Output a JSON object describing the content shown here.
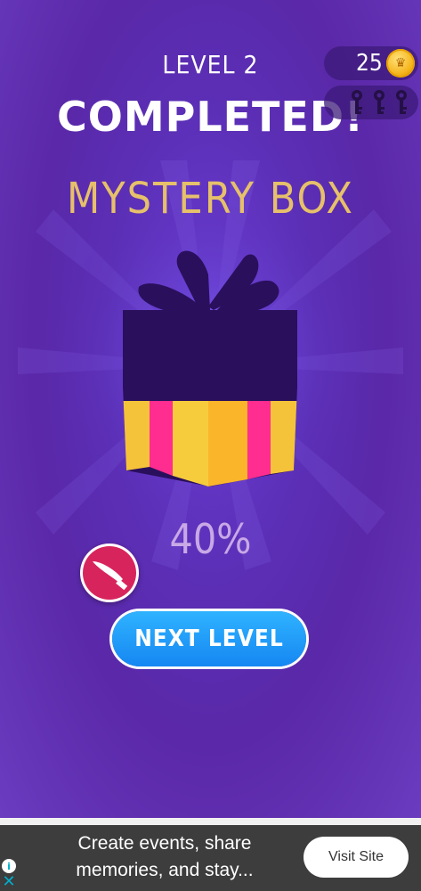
{
  "header": {
    "level_title": "LEVEL 2",
    "completed_title": "COMPLETED!"
  },
  "currency": {
    "coins": "25",
    "coin_icon": "crown-coin-icon",
    "keys_collected": 0,
    "keys_total": 3,
    "key_icon": "key-icon"
  },
  "reward": {
    "title": "MYSTERY BOX",
    "progress_text": "40%",
    "progress": 0.4,
    "box_icon": "gift-box-icon",
    "item_icon": "knife-icon"
  },
  "actions": {
    "next_level_label": "NEXT LEVEL"
  },
  "ad": {
    "text_line1": "Create events, share",
    "text_line2": "memories, and stay...",
    "button_label": "Visit Site",
    "info_icon": "info-icon",
    "close_icon": "close-icon"
  },
  "colors": {
    "background": "#5a28a8",
    "title_gold": "#e6c06a",
    "button_blue": "#1f9cf7",
    "badge_pink": "#d8245c"
  }
}
